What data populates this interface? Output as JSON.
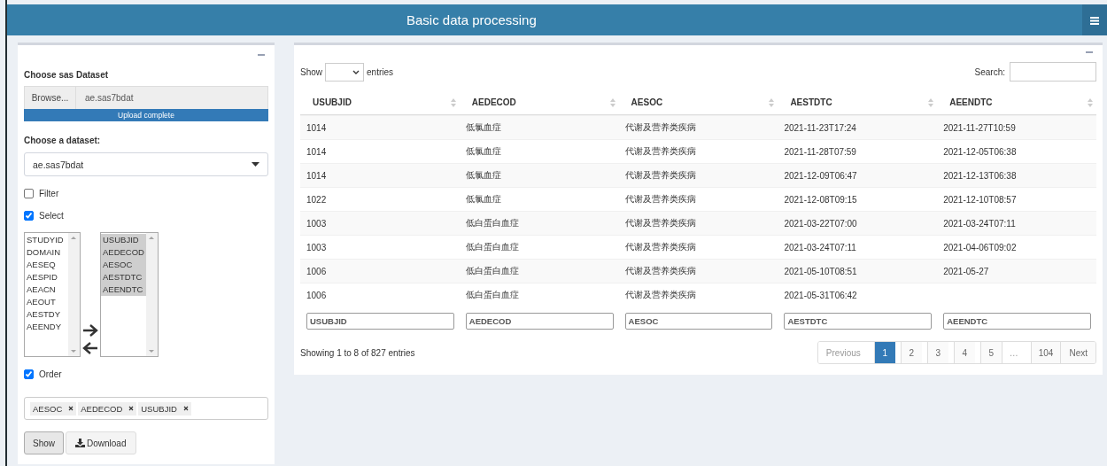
{
  "header": {
    "title": "Basic data processing"
  },
  "sidebar": {
    "file_label": "Choose sas Dataset",
    "browse_button": "Browse...",
    "file_name": "ae.sas7bdat",
    "upload": {
      "label": "Upload complete",
      "level": 1
    },
    "dataset_label": "Choose a dataset:",
    "dataset_value": "ae.sas7bdat",
    "filter": {
      "label": "Filter",
      "checked": false
    },
    "select": {
      "label": "Select",
      "checked": true
    },
    "available": [
      {
        "label": "STUDYID",
        "selected": false
      },
      {
        "label": "DOMAIN",
        "selected": false
      },
      {
        "label": "AESEQ",
        "selected": false
      },
      {
        "label": "AESPID",
        "selected": false
      },
      {
        "label": "AEACN",
        "selected": false
      },
      {
        "label": "AEOUT",
        "selected": false
      },
      {
        "label": "AESTDY",
        "selected": false
      },
      {
        "label": "AEENDY",
        "selected": false
      }
    ],
    "chosen": [
      {
        "label": "USUBJID",
        "selected": true
      },
      {
        "label": "AEDECOD",
        "selected": true
      },
      {
        "label": "AESOC",
        "selected": true
      },
      {
        "label": "AESTDTC",
        "selected": true
      },
      {
        "label": "AEENDTC",
        "selected": true
      }
    ],
    "order": {
      "label": "Order",
      "checked": true
    },
    "order_tags": [
      "AESOC",
      "AEDECOD",
      "USUBJID"
    ],
    "buttons": [
      {
        "label": "Show",
        "kind": "plain"
      },
      {
        "label": "Download",
        "kind": "download"
      }
    ]
  },
  "table": {
    "length_label_before": "Show",
    "length_label_after": "entries",
    "search_label": "Search:",
    "columns": [
      "USUBJID",
      "AEDECOD",
      "AESOC",
      "AESTDTC",
      "AEENDTC"
    ],
    "rows": [
      [
        "1014",
        "低氯血症",
        "代谢及营养类疾病",
        "2021-11-23T17:24",
        "2021-11-27T10:59"
      ],
      [
        "1014",
        "低氯血症",
        "代谢及营养类疾病",
        "2021-11-28T07:59",
        "2021-12-05T06:38"
      ],
      [
        "1014",
        "低氯血症",
        "代谢及营养类疾病",
        "2021-12-09T06:47",
        "2021-12-13T06:38"
      ],
      [
        "1022",
        "低氯血症",
        "代谢及营养类疾病",
        "2021-12-08T09:15",
        "2021-12-10T08:57"
      ],
      [
        "1003",
        "低白蛋白血症",
        "代谢及营养类疾病",
        "2021-03-22T07:00",
        "2021-03-24T07:11"
      ],
      [
        "1003",
        "低白蛋白血症",
        "代谢及营养类疾病",
        "2021-03-24T07:11",
        "2021-04-06T09:02"
      ],
      [
        "1006",
        "低白蛋白血症",
        "代谢及营养类疾病",
        "2021-05-10T08:51",
        "2021-05-27"
      ],
      [
        "1006",
        "低白蛋白血症",
        "代谢及营养类疾病",
        "2021-05-31T06:42",
        ""
      ]
    ],
    "column_filters": [
      {
        "placeholder": "USUBJID"
      },
      {
        "placeholder": "AEDECOD"
      },
      {
        "placeholder": "AESOC"
      },
      {
        "placeholder": "AESTDTC"
      },
      {
        "placeholder": "AEENDTC"
      }
    ],
    "info": "Showing 1 to 8 of 827 entries",
    "pagination": [
      {
        "label": "Previous",
        "kind": "nav",
        "disabled": true,
        "selected": false
      },
      {
        "label": "1",
        "kind": "page",
        "disabled": false,
        "selected": true
      },
      {
        "label": "2",
        "kind": "page",
        "disabled": false,
        "selected": false
      },
      {
        "label": "3",
        "kind": "page",
        "disabled": false,
        "selected": false
      },
      {
        "label": "4",
        "kind": "page",
        "disabled": false,
        "selected": false
      },
      {
        "label": "5",
        "kind": "page",
        "disabled": false,
        "selected": false
      },
      {
        "label": "…",
        "kind": "ellipsis",
        "disabled": true,
        "selected": false
      },
      {
        "label": "104",
        "kind": "page",
        "disabled": false,
        "selected": false
      },
      {
        "label": "Next",
        "kind": "nav",
        "disabled": false,
        "selected": false
      }
    ]
  }
}
